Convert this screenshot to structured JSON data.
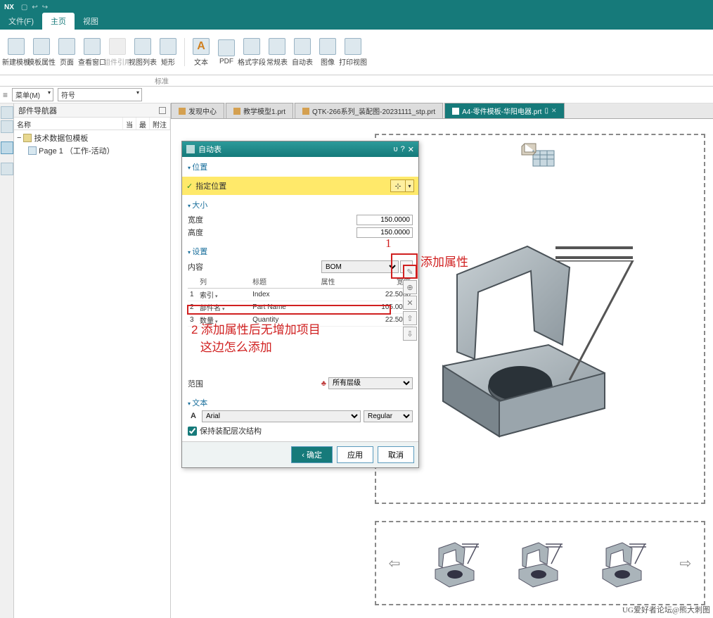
{
  "app": {
    "logo": "NX"
  },
  "menu": {
    "file": "文件(F)",
    "home": "主页",
    "view": "视图"
  },
  "ribbon": {
    "items": [
      {
        "l": "新建模板"
      },
      {
        "l": "模板属性"
      },
      {
        "l": "页面"
      },
      {
        "l": "查看窗口"
      },
      {
        "l": "组件引用",
        "dis": true
      },
      {
        "l": "视图列表"
      },
      {
        "l": "矩形"
      },
      {
        "l": "文本"
      },
      {
        "l": "PDF"
      },
      {
        "l": "格式字段"
      },
      {
        "l": "常规表"
      },
      {
        "l": "自动表"
      },
      {
        "l": "图像"
      },
      {
        "l": "打印视图"
      }
    ],
    "group": "标准"
  },
  "dropdowns": {
    "menu": "菜单(M)",
    "sym": "符号"
  },
  "nav": {
    "title": "部件导航器",
    "cols": {
      "name": "名称",
      "c2": "当",
      "c3": "最",
      "c4": "附注"
    },
    "root": "技术数据包模板",
    "child": "Page 1 （工作-活动）"
  },
  "tabs": {
    "t1": "发现中心",
    "t2": "教学模型1.prt",
    "t3": "QTK-266系列_装配图-20231111_stp.prt",
    "t4": "A4-零件模板-华阳电器.prt"
  },
  "dialog": {
    "title": "自动表",
    "sec_pos": "位置",
    "pick": "指定位置",
    "sec_size": "大小",
    "width_l": "宽度",
    "width_v": "150.0000",
    "height_l": "高度",
    "height_v": "150.0000",
    "sec_set": "设置",
    "content_l": "内容",
    "content_v": "BOM",
    "cols": {
      "c1": "列",
      "c2": "标题",
      "c3": "属性",
      "c4": "宽度"
    },
    "rows": [
      {
        "n": "1",
        "col": "索引",
        "title": "Index",
        "w": "22.5000"
      },
      {
        "n": "2",
        "col": "部件名",
        "title": "Part Name",
        "w": "105.0000"
      },
      {
        "n": "3",
        "col": "数量",
        "title": "Quantity",
        "w": "22.5000"
      }
    ],
    "range_l": "范围",
    "range_v": "所有层级",
    "sec_text": "文本",
    "font": "Arial",
    "font_style": "Regular",
    "chk": "保持装配层次结构",
    "ok": "确定",
    "apply": "应用",
    "cancel": "取消"
  },
  "anno": {
    "a1_num": "1",
    "a1_text": "添加属性",
    "a2_num": "2",
    "a2_line1": "添加属性后无增加项目",
    "a2_line2": "这边怎么添加"
  },
  "watermark": "UG爱好者论坛@熊大刺图"
}
